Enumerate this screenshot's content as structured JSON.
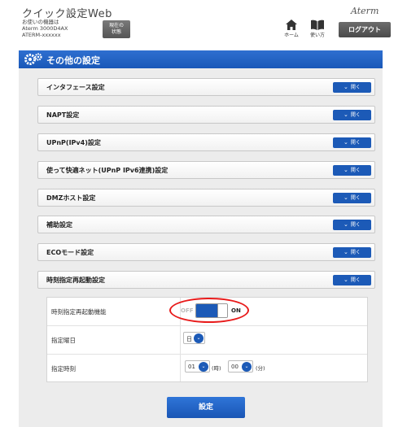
{
  "header": {
    "title": "クイック設定Web",
    "device_line1": "お使いの機器は",
    "device_line2": "Aterm 3000D4AX",
    "device_line3": "ATERM-xxxxxx",
    "status_label_1": "現在の",
    "status_label_2": "状態",
    "home_label": "ホーム",
    "help_label": "使い方",
    "logout_label": "ログアウト",
    "brand": "Aterm"
  },
  "panel": {
    "title": "その他の設定",
    "open_label": "開く",
    "sections": [
      {
        "label": "インタフェース設定"
      },
      {
        "label": "NAPT設定"
      },
      {
        "label": "UPnP(IPv4)設定"
      },
      {
        "label": "使って快適ネット(UPnP IPv6連携)設定"
      },
      {
        "label": "DMZホスト設定"
      },
      {
        "label": "補助設定"
      },
      {
        "label": "ECOモード設定"
      },
      {
        "label": "時刻指定再起動設定"
      }
    ]
  },
  "detail": {
    "feature_label": "時刻指定再起動機能",
    "off_label": "OFF",
    "on_label": "ON",
    "toggle_state": "ON",
    "day_label": "指定曜日",
    "day_value": "日",
    "time_label": "指定時刻",
    "hour_value": "01",
    "hour_unit": "(時)",
    "minute_value": "00",
    "minute_unit": "(分)"
  },
  "submit_label": "設定",
  "colors": {
    "accent": "#1c5ab7",
    "highlight": "#e81b1b",
    "panel_bg": "#ececec"
  }
}
